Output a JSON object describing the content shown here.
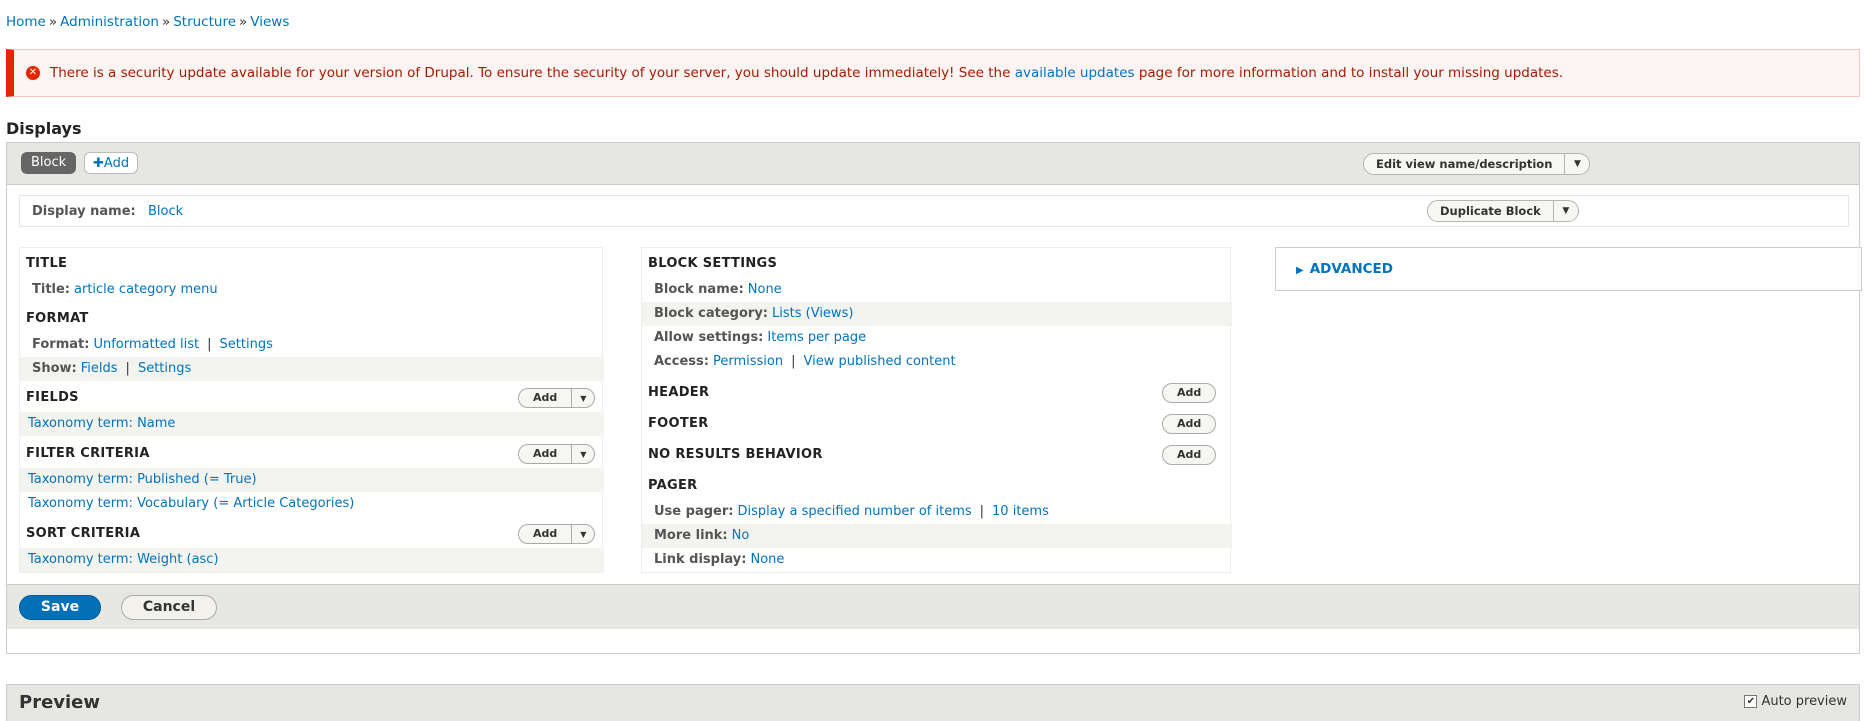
{
  "breadcrumb": [
    "Home",
    "Administration",
    "Structure",
    "Views"
  ],
  "breadcrumb_sep": "»",
  "alert": {
    "text_before": "There is a security update available for your version of Drupal. To ensure the security of your server, you should update immediately! See the",
    "link": "available updates",
    "text_after": "page for more information and to install your missing updates."
  },
  "displays_title": "Displays",
  "tabs": {
    "active": "Block",
    "add": "Add"
  },
  "edit_view_btn": "Edit view name/description",
  "display_name": {
    "label": "Display name:",
    "value": "Block"
  },
  "duplicate_btn": "Duplicate Block",
  "col1": {
    "title_h": "TITLE",
    "title_label": "Title:",
    "title_value": "article category menu",
    "format_h": "FORMAT",
    "format_label": "Format:",
    "format_value": "Unformatted list",
    "format_settings": "Settings",
    "show_label": "Show:",
    "show_value": "Fields",
    "show_settings": "Settings",
    "fields_h": "FIELDS",
    "fields": [
      "Taxonomy term: Name"
    ],
    "filter_h": "FILTER CRITERIA",
    "filters": [
      "Taxonomy term: Published (= True)",
      "Taxonomy term: Vocabulary (= Article Categories)"
    ],
    "sort_h": "SORT CRITERIA",
    "sorts": [
      "Taxonomy term: Weight (asc)"
    ],
    "add": "Add"
  },
  "col2": {
    "block_settings_h": "BLOCK SETTINGS",
    "block_name_label": "Block name:",
    "block_name_value": "None",
    "block_category_label": "Block category:",
    "block_category_value": "Lists (Views)",
    "allow_label": "Allow settings:",
    "allow_value": "Items per page",
    "access_label": "Access:",
    "access_value": "Permission",
    "access_value2": "View published content",
    "header_h": "HEADER",
    "footer_h": "FOOTER",
    "no_results_h": "NO RESULTS BEHAVIOR",
    "pager_h": "PAGER",
    "use_pager_label": "Use pager:",
    "use_pager_value": "Display a specified number of items",
    "use_pager_value2": "10 items",
    "more_link_label": "More link:",
    "more_link_value": "No",
    "link_display_label": "Link display:",
    "link_display_value": "None",
    "add": "Add"
  },
  "advanced": "ADVANCED",
  "save": "Save",
  "cancel": "Cancel",
  "preview": {
    "title": "Preview",
    "auto_label": "Auto preview",
    "auto_checked": true
  }
}
